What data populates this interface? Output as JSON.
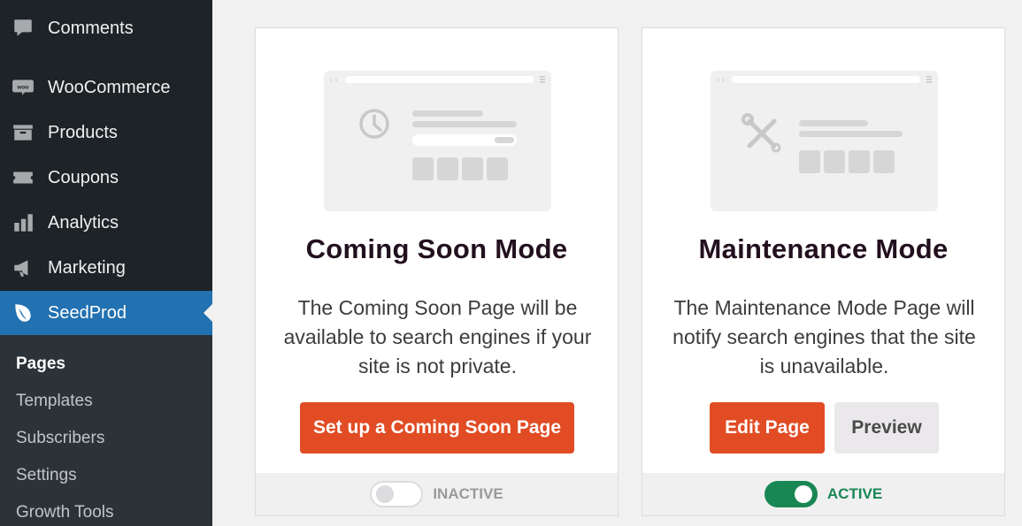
{
  "sidebar": {
    "items": [
      {
        "label": "Comments",
        "icon": "comments-icon"
      },
      {
        "label": "WooCommerce",
        "icon": "woocommerce-icon"
      },
      {
        "label": "Products",
        "icon": "products-icon"
      },
      {
        "label": "Coupons",
        "icon": "coupons-icon"
      },
      {
        "label": "Analytics",
        "icon": "analytics-icon"
      },
      {
        "label": "Marketing",
        "icon": "marketing-icon"
      },
      {
        "label": "SeedProd",
        "icon": "seedprod-icon"
      }
    ],
    "submenu": [
      "Pages",
      "Templates",
      "Subscribers",
      "Settings",
      "Growth Tools"
    ],
    "active_item": "SeedProd",
    "current_submenu": "Pages",
    "accent_color": "#2271b1"
  },
  "coming_soon": {
    "title": "Coming Soon Mode",
    "description": "The Coming Soon Page will be available to search engines if your site is not private.",
    "button": "Set up a Coming Soon Page",
    "status": "INACTIVE",
    "enabled": false,
    "illustration_icon": "clock-icon"
  },
  "maintenance": {
    "title": "Maintenance Mode",
    "description": "The Maintenance Mode Page will notify search engines that the site is unavailable.",
    "edit_button": "Edit Page",
    "preview_button": "Preview",
    "status": "ACTIVE",
    "enabled": true,
    "illustration_icon": "tools-icon"
  },
  "colors": {
    "primary_button": "#e14c24",
    "active_green": "#198754"
  }
}
